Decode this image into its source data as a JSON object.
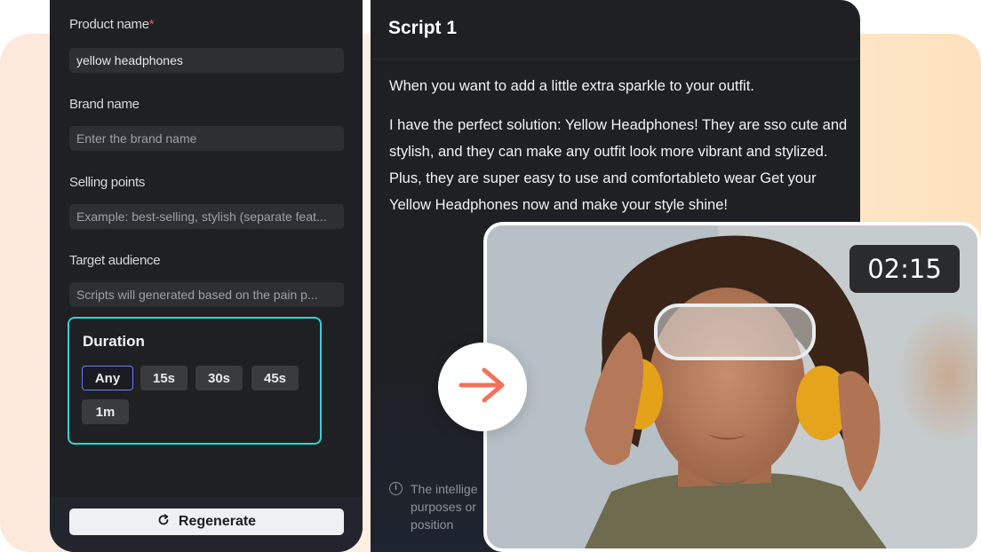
{
  "form": {
    "product_name": {
      "label": "Product name",
      "required_mark": "*",
      "value": "yellow headphones"
    },
    "brand_name": {
      "label": "Brand name",
      "placeholder": "Enter the brand name"
    },
    "selling_points": {
      "label": "Selling points",
      "placeholder": "Example: best-selling, stylish (separate feat..."
    },
    "target_audience": {
      "label": "Target audience",
      "placeholder": "Scripts will generated based on the pain p..."
    },
    "duration": {
      "title": "Duration",
      "options": [
        "Any",
        "15s",
        "30s",
        "45s",
        "1m"
      ],
      "selected": "Any"
    },
    "regenerate_label": "Regenerate"
  },
  "script": {
    "title": "Script 1",
    "paragraphs": [
      "When you want to add a little extra sparkle to your outfit.",
      "I have the perfect solution: Yellow Headphones! They are sso cute and stylish, and they can make any outfit look more vibrant and stylized. Plus, they are super easy to use and comfortableto wear Get your Yellow Headphones now and make your style shine!"
    ],
    "info_note": "The intellige purposes or position"
  },
  "preview": {
    "timer": "02:15"
  },
  "colors": {
    "accent_cyan": "#2fd3d9",
    "selected_chip_border": "#6b7cff",
    "arrow": "#f4705a",
    "required": "#ff4d4f"
  },
  "icons": {
    "regenerate": "refresh-icon",
    "transition": "arrow-right-icon",
    "info": "info-icon"
  }
}
